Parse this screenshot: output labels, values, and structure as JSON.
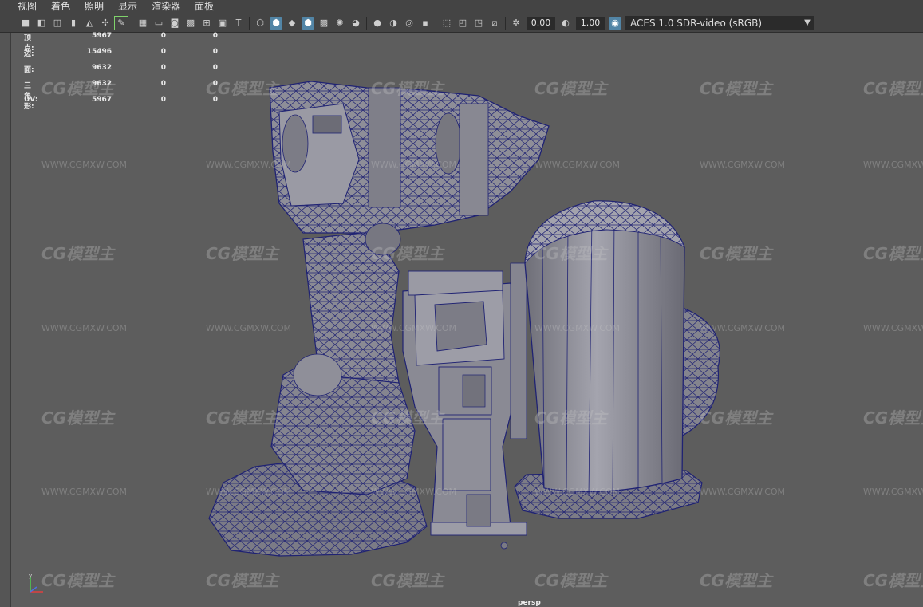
{
  "menu": [
    "视图",
    "着色",
    "照明",
    "显示",
    "渲染器",
    "面板"
  ],
  "toolbar": {
    "exposure_value": "0.00",
    "gamma_value": "1.00",
    "colorspace": "ACES 1.0 SDR-video (sRGB)"
  },
  "stats": [
    {
      "label": "顶点:",
      "v1": "5967",
      "v2": "0",
      "v3": "0"
    },
    {
      "label": "边:",
      "v1": "15496",
      "v2": "0",
      "v3": "0"
    },
    {
      "label": "面:",
      "v1": "9632",
      "v2": "0",
      "v3": "0"
    },
    {
      "label": "三角形:",
      "v1": "9632",
      "v2": "0",
      "v3": "0"
    },
    {
      "label": "UV:",
      "v1": "5967",
      "v2": "0",
      "v3": "0"
    }
  ],
  "viewport": {
    "camera": "persp",
    "watermark_logo": "CG模型主",
    "watermark_url": "WWW.CGMXW.COM",
    "background_color": "#5d5d5d",
    "mesh_fill": "#8e8e98",
    "wire_color": "#1f2273"
  }
}
